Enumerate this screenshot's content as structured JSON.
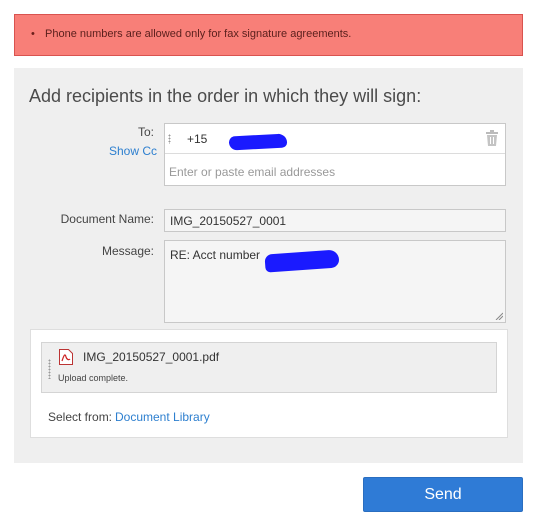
{
  "error": {
    "bullet": "•",
    "message": "Phone numbers are allowed only for fax signature agreements."
  },
  "form": {
    "title": "Add recipients in the order in which they will sign:",
    "to_label": "To:",
    "show_cc": "Show Cc",
    "recipient_value": "+15",
    "email_placeholder": "Enter or paste email addresses",
    "document_name_label": "Document Name:",
    "document_name_value": "IMG_20150527_0001",
    "message_label": "Message:",
    "message_value": "RE: Acct number"
  },
  "files": {
    "items": [
      {
        "name": "IMG_20150527_0001.pdf",
        "status": "Upload complete."
      }
    ],
    "select_from_label": "Select from:",
    "document_library": "Document Library"
  },
  "actions": {
    "send": "Send"
  },
  "colors": {
    "error_bg": "#f87f78",
    "panel_bg": "#efefef",
    "link": "#2d7fcf",
    "send_button": "#2f7bd6",
    "redaction": "#1a1aff"
  },
  "icons": {
    "trash": "trash-icon",
    "pdf": "pdf-file-icon",
    "drag": "drag-handle-icon"
  }
}
